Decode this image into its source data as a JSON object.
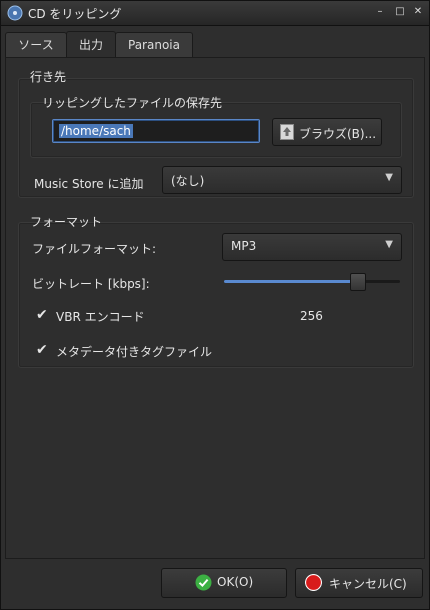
{
  "window": {
    "title": "CD をリッピング",
    "controls": [
      "–",
      "□",
      "✕"
    ]
  },
  "tabs": [
    {
      "label": "ソース",
      "active": false
    },
    {
      "label": "出力",
      "active": true
    },
    {
      "label": "Paranoia",
      "active": false
    }
  ],
  "destination": {
    "section_label": "行き先",
    "save_label": "リッピングしたファイルの保存先",
    "path_value": "/home/sach",
    "browse_label": "ブラウズ(B)...",
    "music_store_label": "Music Store に追加",
    "music_store_value": "(なし)"
  },
  "format": {
    "section_label": "フォーマット",
    "file_format_label": "ファイルフォーマット:",
    "file_format_value": "MP3",
    "bitrate_label": "ビットレート [kbps]:",
    "bitrate_value": "256",
    "bitrate_fraction": 0.75,
    "vbr_label": "VBR エンコード",
    "vbr_checked": true,
    "tag_label": "メタデータ付きタグファイル",
    "tag_checked": true
  },
  "buttons": {
    "ok_label": "OK(O)",
    "cancel_label": "キャンセル(C)"
  },
  "colors": {
    "accent": "#5a8ad0",
    "ok_icon": "#3cb043",
    "cancel_icon": "#d81b1b"
  }
}
